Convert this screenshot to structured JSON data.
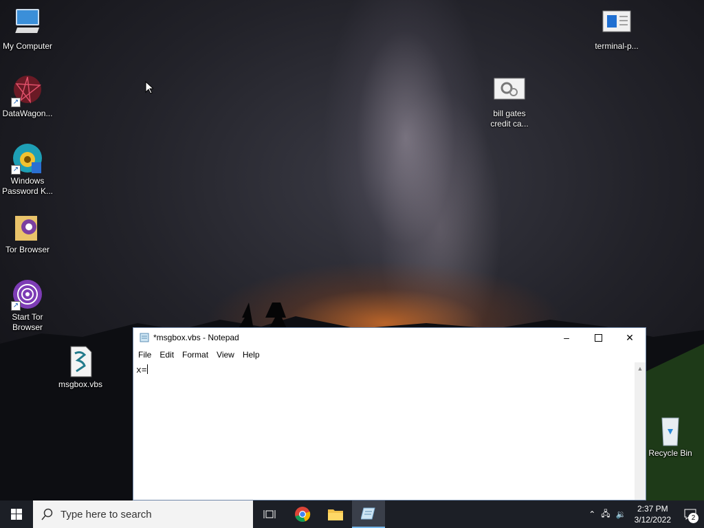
{
  "desktop": {
    "icons": [
      {
        "label": "My Computer"
      },
      {
        "label": "DataWagon..."
      },
      {
        "label": "Windows Password K..."
      },
      {
        "label": "Tor Browser"
      },
      {
        "label": "Start Tor Browser"
      },
      {
        "label": "msgbox.vbs"
      },
      {
        "label": "terminal-p..."
      },
      {
        "label": "bill gates credit ca..."
      },
      {
        "label": "Recycle Bin"
      }
    ]
  },
  "notepad": {
    "title": "*msgbox.vbs - Notepad",
    "menu": [
      "File",
      "Edit",
      "Format",
      "View",
      "Help"
    ],
    "content": "x="
  },
  "taskbar": {
    "search_placeholder": "Type here to search",
    "time": "2:37 PM",
    "date": "3/12/2022",
    "notification_count": "2"
  }
}
